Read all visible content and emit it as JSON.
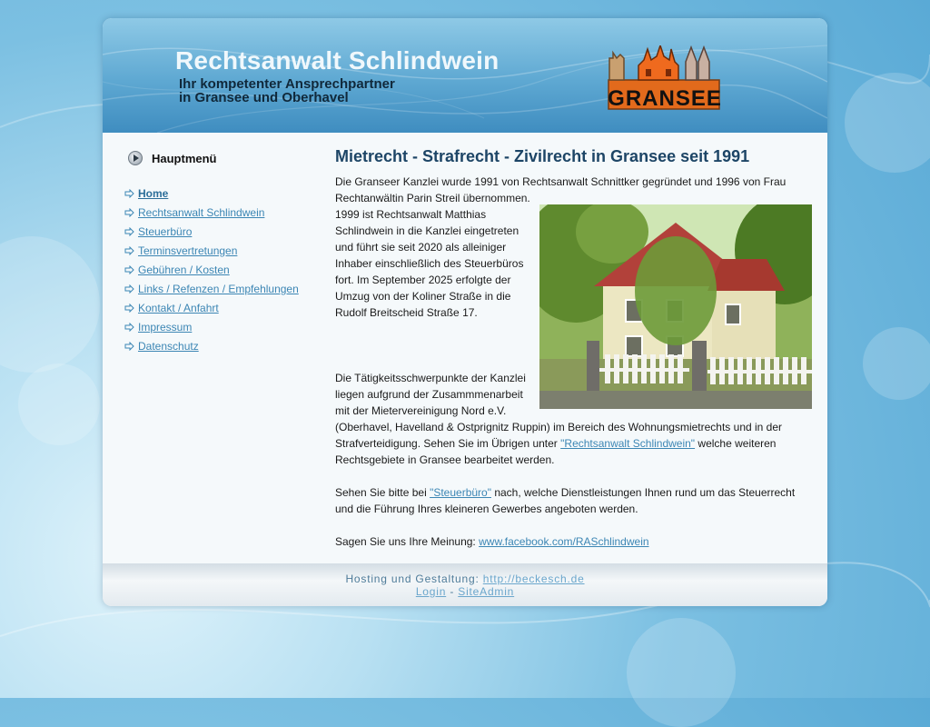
{
  "header": {
    "title": "Rechtsanwalt Schlindwein",
    "tagline_line1": "Ihr kompetenter Ansprechpartner",
    "tagline_line2": "in Gransee und Oberhavel",
    "logo_text": "GRANSEE"
  },
  "sidebar": {
    "title": "Hauptmenü",
    "items": [
      {
        "label": "Home",
        "active": true
      },
      {
        "label": "Rechtsanwalt Schlindwein"
      },
      {
        "label": "Steuerbüro"
      },
      {
        "label": "Terminsvertretungen"
      },
      {
        "label": "Gebühren / Kosten"
      },
      {
        "label": "Links / Refenzen / Empfehlungen"
      },
      {
        "label": "Kontakt / Anfahrt"
      },
      {
        "label": "Impressum"
      },
      {
        "label": "Datenschutz"
      }
    ]
  },
  "main": {
    "heading": "Mietrecht - Strafrecht - Zivilrecht in Gransee seit 1991",
    "intro_line1": "Die Granseer Kanzlei wurde 1991 von Rechtsanwalt Schnittker gegründet und 1996 von Frau",
    "intro_line2": "Rechtanwältin Parin Streil übernommen.",
    "history_lines": [
      "1999 ist Rechtsanwalt Matthias",
      "Schlindwein in die Kanzlei eingetreten",
      "und führt sie seit 2020 als alleiniger",
      "Inhaber einschließlich des Steuerbüros",
      "fort. Im September 2025 erfolgte der",
      "Umzug von der Koliner Straße in die",
      "Rudolf Breitscheid Straße 17."
    ],
    "focus_lines": [
      "Die Tätigkeitsschwerpunkte der Kanzlei",
      "liegen aufgrund der Zusammmenarbeit",
      "mit der Mietervereinigung Nord e.V.",
      "(Oberhavel, Havelland  & Ostprignitz Ruppin) im Bereich des Wohnungsmietrechts  und in der"
    ],
    "focus_line5_before": "Strafverteidigung. Sehen Sie im Übrigen unter ",
    "focus_link": "\"Rechtsanwalt Schlindwein\"",
    "focus_line5_after": " welche weiteren",
    "focus_line6": "Rechtsgebiete in Gransee bearbeitet werden.",
    "tax_before": "Sehen Sie bitte bei ",
    "tax_link": "\"Steuerbüro\"",
    "tax_after": " nach, welche Dienstleistungen Ihnen rund um das Steuerrecht",
    "tax_line2": "und die Führung Ihres kleineren Gewerbes angeboten werden.",
    "opinion_text": "Sagen Sie uns Ihre Meinung: ",
    "facebook_link": "www.facebook.com/RASchlindwein"
  },
  "footer": {
    "hosting_text": "Hosting und Gestaltung: ",
    "hosting_link": "http://beckesch.de",
    "login": "Login",
    "separator": " - ",
    "siteadmin": "SiteAdmin"
  },
  "colors": {
    "link": "#3c86b4",
    "heading": "#1d4566",
    "header_blue": "#5ea8d2"
  }
}
